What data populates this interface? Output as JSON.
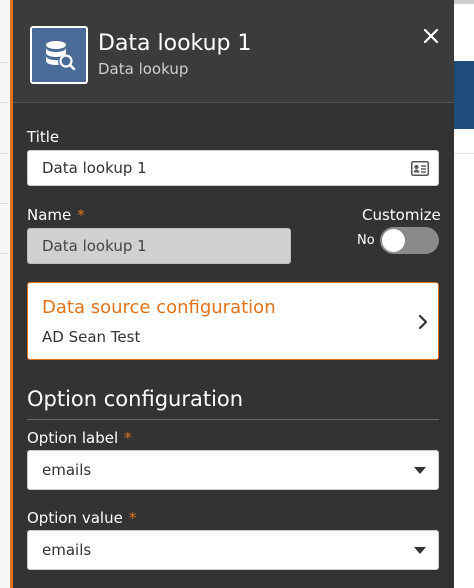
{
  "header": {
    "title": "Data lookup 1",
    "subtitle": "Data lookup",
    "icon": "database-search-icon"
  },
  "title_field": {
    "label": "Title",
    "value": "Data lookup 1"
  },
  "name_field": {
    "label": "Name",
    "required_mark": "*",
    "value": "Data lookup 1"
  },
  "customize": {
    "label": "Customize",
    "toggle_text": "No",
    "on": false
  },
  "data_source": {
    "title": "Data source configuration",
    "value": "AD Sean Test"
  },
  "option_configuration": {
    "heading": "Option configuration"
  },
  "option_label": {
    "label": "Option label",
    "required_mark": "*",
    "selected": "emails"
  },
  "option_value": {
    "label": "Option value",
    "required_mark": "*",
    "selected": "emails"
  },
  "colors": {
    "accent": "#e2731a",
    "panel": "#333333",
    "icon_bg": "#4a6a97"
  }
}
